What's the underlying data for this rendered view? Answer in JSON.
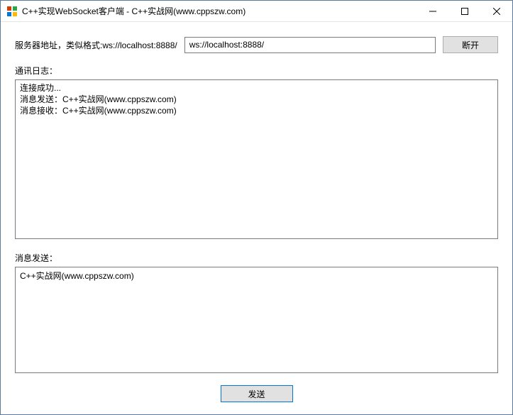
{
  "window": {
    "title": "C++实现WebSocket客户端 - C++实战网(www.cppszw.com)"
  },
  "server": {
    "label": "服务器地址，类似格式:ws://localhost:8888/",
    "value": "ws://localhost:8888/"
  },
  "buttons": {
    "disconnect": "断开",
    "send": "发送"
  },
  "log": {
    "label": "通讯日志：",
    "content": "连接成功...\n消息发送：C++实战网(www.cppszw.com)\n消息接收：C++实战网(www.cppszw.com)"
  },
  "send": {
    "label": "消息发送：",
    "content": "C++实战网(www.cppszw.com)"
  }
}
